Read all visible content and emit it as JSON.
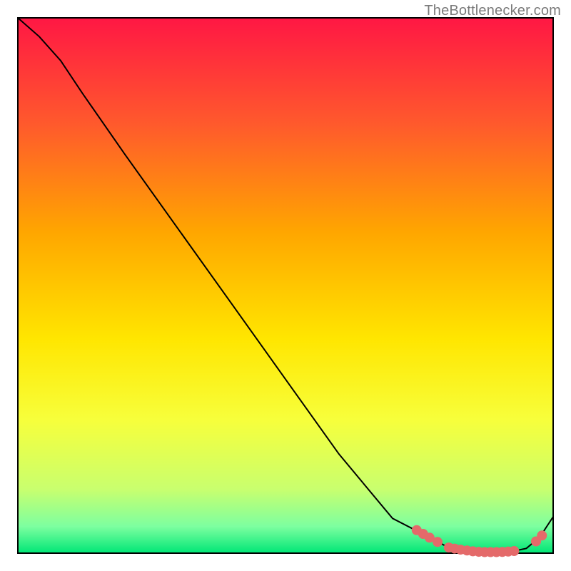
{
  "watermark": "TheBottlenecker.com",
  "chart_data": {
    "type": "line",
    "title": "",
    "xlabel": "",
    "ylabel": "",
    "xlim": [
      0,
      100
    ],
    "ylim": [
      0,
      100
    ],
    "background_gradient": {
      "stops": [
        {
          "offset": 0.0,
          "color": "#ff1744"
        },
        {
          "offset": 0.2,
          "color": "#ff5a2c"
        },
        {
          "offset": 0.4,
          "color": "#ffa600"
        },
        {
          "offset": 0.6,
          "color": "#ffe600"
        },
        {
          "offset": 0.75,
          "color": "#f7ff3b"
        },
        {
          "offset": 0.88,
          "color": "#c9ff6e"
        },
        {
          "offset": 0.95,
          "color": "#7dffa0"
        },
        {
          "offset": 1.0,
          "color": "#00e676"
        }
      ]
    },
    "series": [
      {
        "name": "bottleneck-curve",
        "color": "#000000",
        "x": [
          0,
          4,
          8,
          12,
          20,
          30,
          40,
          50,
          60,
          70,
          76,
          80,
          83,
          86,
          89,
          92,
          95,
          97.5,
          100
        ],
        "y": [
          100,
          96.5,
          92,
          86,
          74.5,
          60.5,
          46.5,
          32.5,
          18.5,
          6.5,
          3.4,
          1.3,
          0.6,
          0.25,
          0.2,
          0.25,
          0.9,
          3.0,
          6.8
        ]
      }
    ],
    "highlight_dots": {
      "color": "#e46a6a",
      "radius_px": 7,
      "points": [
        {
          "x": 74.5,
          "y": 4.3
        },
        {
          "x": 75.7,
          "y": 3.6
        },
        {
          "x": 76.9,
          "y": 2.9
        },
        {
          "x": 78.4,
          "y": 2.1
        },
        {
          "x": 80.5,
          "y": 1.05
        },
        {
          "x": 81.6,
          "y": 0.85
        },
        {
          "x": 82.7,
          "y": 0.65
        },
        {
          "x": 83.9,
          "y": 0.5
        },
        {
          "x": 85.0,
          "y": 0.35
        },
        {
          "x": 86.1,
          "y": 0.25
        },
        {
          "x": 87.2,
          "y": 0.2
        },
        {
          "x": 88.3,
          "y": 0.2
        },
        {
          "x": 89.4,
          "y": 0.2
        },
        {
          "x": 90.5,
          "y": 0.23
        },
        {
          "x": 91.6,
          "y": 0.3
        },
        {
          "x": 92.7,
          "y": 0.4
        },
        {
          "x": 96.8,
          "y": 2.2
        },
        {
          "x": 97.9,
          "y": 3.3
        }
      ]
    }
  }
}
